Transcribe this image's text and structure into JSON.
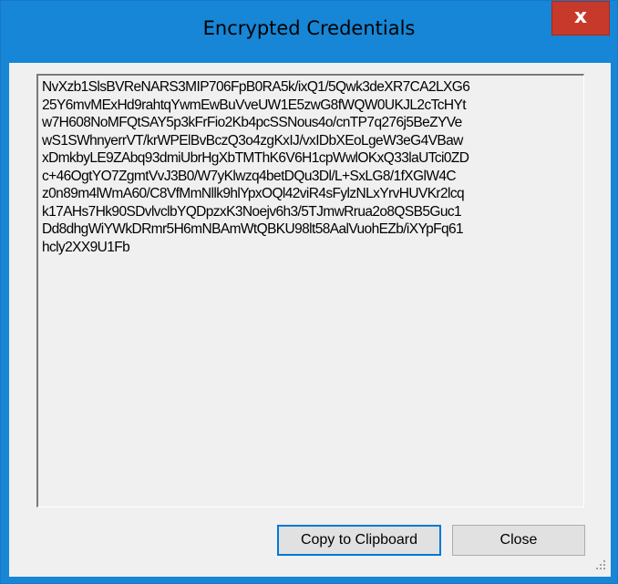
{
  "window": {
    "title": "Encrypted Credentials",
    "close_glyph": "x"
  },
  "credentials": {
    "lines": [
      "NvXzb1SlsBVReNARS3MIP706FpB0RA5k/ixQ1/5Qwk3deXR7CA2LXG6",
      "25Y6mvMExHd9rahtqYwmEwBuVveUW1E5zwG8fWQW0UKJL2cTcHYt",
      "w7H608NoMFQtSAY5p3kFrFio2Kb4pcSSNous4o/cnTP7q276j5BeZYVe",
      "wS1SWhnyerrVT/krWPElBvBczQ3o4zgKxIJ/vxIDbXEoLgeW3eG4VBaw",
      "xDmkbyLE9ZAbq93dmiUbrHgXbTMThK6V6H1cpWwlOKxQ33laUTci0ZD",
      "c+46OgtYO7ZgmtVvJ3B0/W7yKlwzq4betDQu3Dl/L+SxLG8/1fXGlW4C",
      "z0n89m4lWmA60/C8VfMmNllk9hlYpxOQl42viR4sFylzNLxYrvHUVKr2lcq",
      "k17AHs7Hk90SDvlvclbYQDpzxK3Noejv6h3/5TJmwRrua2o8QSB5Guc1",
      "Dd8dhgWiYWkDRmr5H6mNBAmWtQBKU98lt58AalVuohEZb/iXYpFq61",
      "hcly2XX9U1Fb"
    ]
  },
  "buttons": {
    "copy_label": "Copy to Clipboard",
    "close_label": "Close"
  },
  "colors": {
    "titlebar": "#1786d6",
    "close_button": "#c7392b",
    "client_background": "#f0f0f0",
    "focus_border": "#0078d7"
  }
}
